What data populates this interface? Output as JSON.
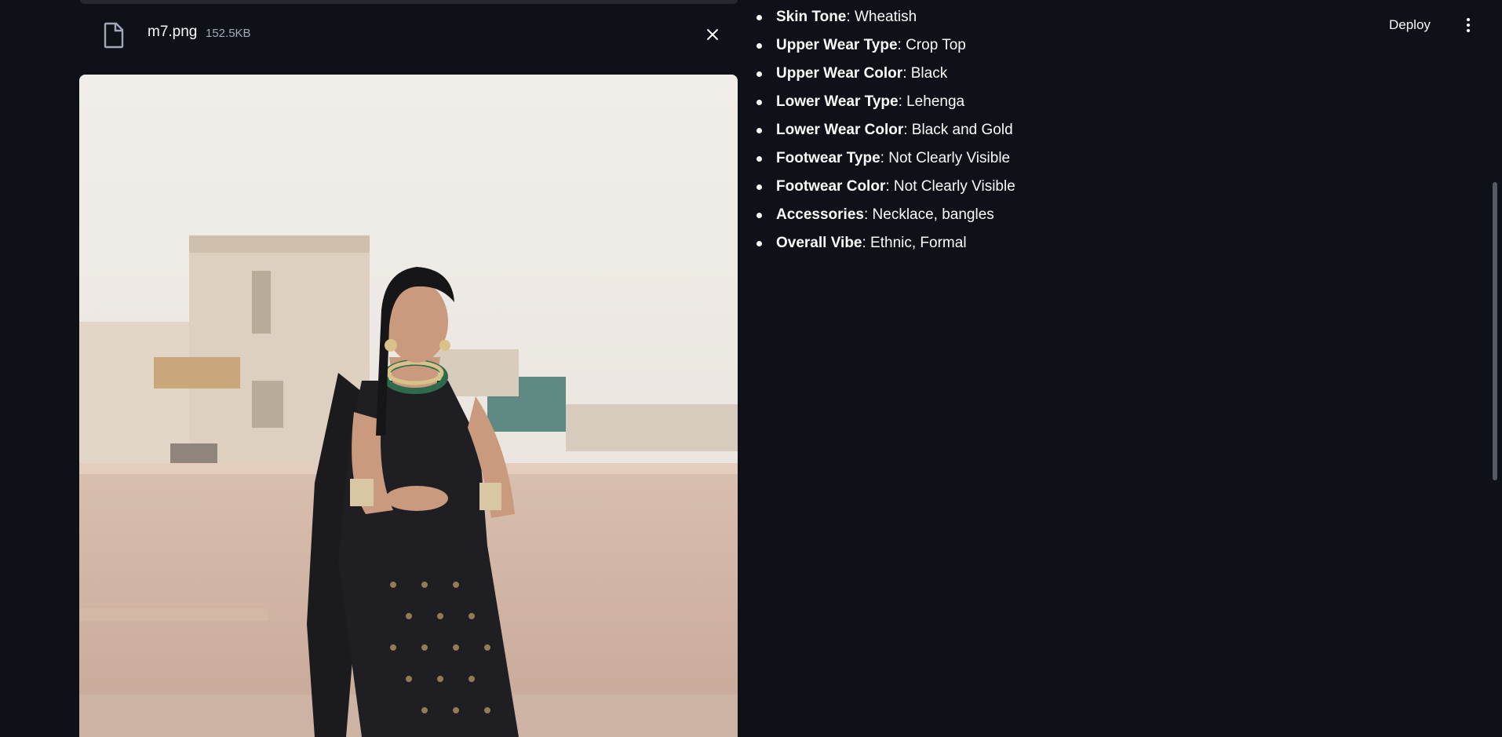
{
  "file": {
    "name": "m7.png",
    "size": "152.5KB"
  },
  "header": {
    "deploy_label": "Deploy"
  },
  "attributes": [
    {
      "key": "Skin Tone",
      "value": ": Wheatish"
    },
    {
      "key": "Upper Wear Type",
      "value": ": Crop Top"
    },
    {
      "key": "Upper Wear Color",
      "value": ": Black"
    },
    {
      "key": "Lower Wear Type",
      "value": ": Lehenga"
    },
    {
      "key": "Lower Wear Color",
      "value": ": Black and Gold"
    },
    {
      "key": "Footwear Type",
      "value": ": Not Clearly Visible"
    },
    {
      "key": "Footwear Color",
      "value": ": Not Clearly Visible"
    },
    {
      "key": "Accessories",
      "value": ": Necklace, bangles"
    },
    {
      "key": "Overall Vibe",
      "value": ": Ethnic, Formal"
    }
  ],
  "icons": {
    "file": "file-icon",
    "close": "close-icon",
    "menu": "kebab-menu-icon"
  },
  "colors": {
    "background": "#0e1117",
    "text": "#fafafa",
    "muted": "#a3a8b8"
  }
}
